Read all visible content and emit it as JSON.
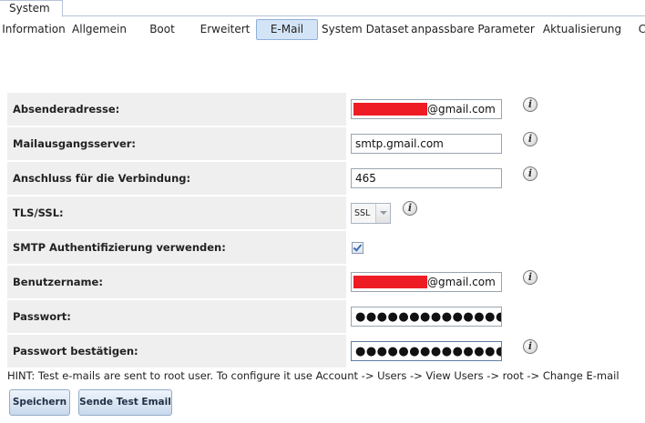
{
  "top_tab": {
    "label": "System"
  },
  "subtabs": [
    {
      "label": "Information"
    },
    {
      "label": "Allgemein"
    },
    {
      "label": "Boot"
    },
    {
      "label": "Erweitert"
    },
    {
      "label": "E-Mail",
      "active": true
    },
    {
      "label": "System Dataset"
    },
    {
      "label": "anpassbare Parameter"
    },
    {
      "label": "Aktualisierung"
    },
    {
      "label": "C"
    }
  ],
  "form": {
    "sender_address": {
      "label": "Absenderadresse:",
      "value_suffix": "@gmail.com"
    },
    "outgoing_server": {
      "label": "Mailausgangsserver:",
      "value": "smtp.gmail.com"
    },
    "port": {
      "label": "Anschluss für die Verbindung:",
      "value": "465"
    },
    "tls_ssl": {
      "label": "TLS/SSL:",
      "value": "SSL"
    },
    "smtp_auth": {
      "label": "SMTP Authentifizierung verwenden:",
      "checked": true
    },
    "username": {
      "label": "Benutzername:",
      "value_suffix": "@gmail.com"
    },
    "password": {
      "label": "Passwort:",
      "masked": "●●●●●●●●●●●●●●●●"
    },
    "password_confirm": {
      "label": "Passwort bestätigen:",
      "masked": "●●●●●●●●●●●●●●●●"
    }
  },
  "info_icon_glyph": "i",
  "colors": {
    "redaction": "#ee1c24",
    "active_tab": "#d3e4f6",
    "label_bg": "#efefef"
  },
  "hint": "HINT: Test e-mails are sent to root user. To configure it use Account -> Users -> View Users -> root -> Change E-mail",
  "buttons": {
    "save": "Speichern",
    "send_test": "Sende Test Email"
  }
}
